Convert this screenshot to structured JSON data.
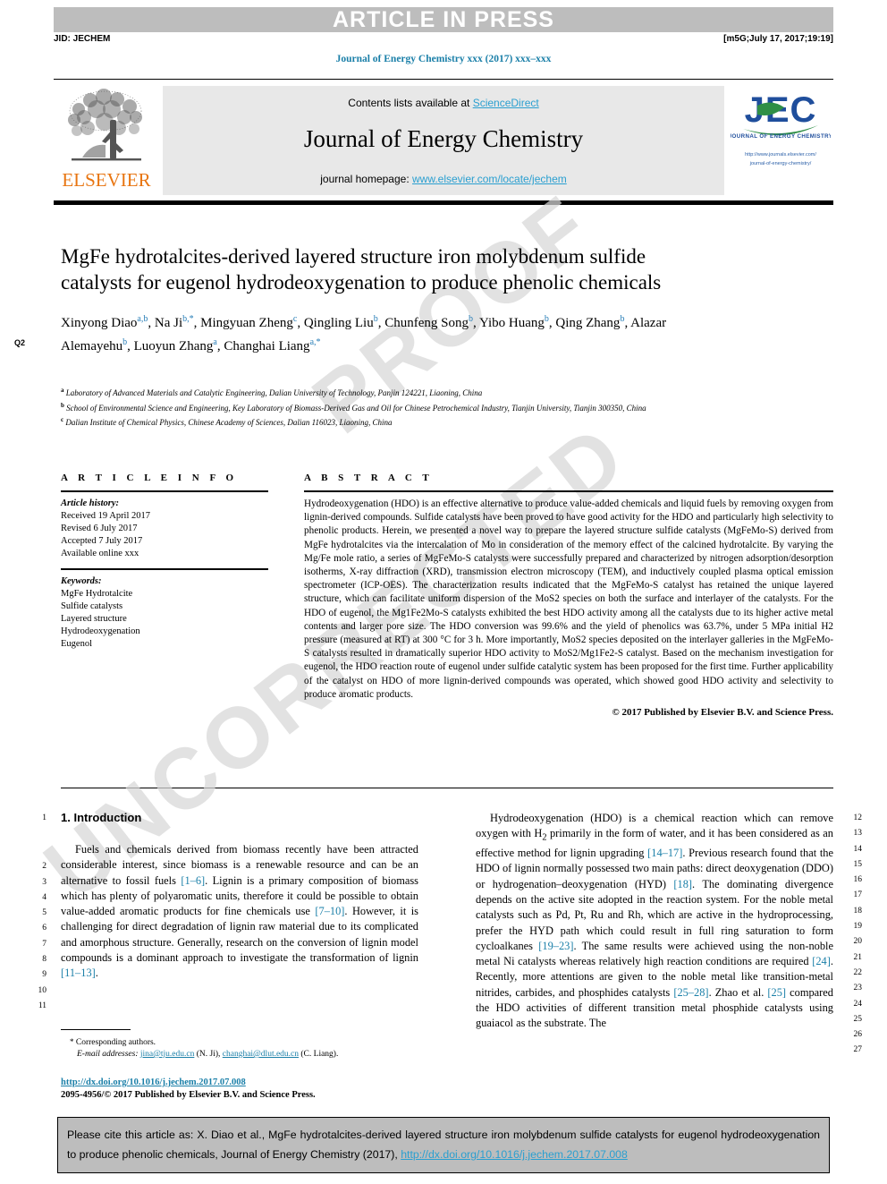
{
  "header": {
    "banner": "ARTICLE IN PRESS",
    "jid": "JID: JECHEM",
    "build_stamp": "[m5G;July 17, 2017;19:19]",
    "journal_ref": "Journal of Energy Chemistry xxx (2017) xxx–xxx"
  },
  "masthead": {
    "contents_prefix": "Contents lists available at ",
    "sciencedirect": "ScienceDirect",
    "journal_title": "Journal of Energy Chemistry",
    "homepage_prefix": "journal homepage: ",
    "homepage_url": "www.elsevier.com/locate/jechem",
    "elsevier_wordmark": "ELSEVIER",
    "jec_wordmark": "JEC",
    "jec_tagline": "JOURNAL OF ENERGY CHEMISTRY",
    "jec_url_line1": "http://www.journals.elsevier.com/",
    "jec_url_line2": "journal-of-energy-chemistry/"
  },
  "article": {
    "title": "MgFe hydrotalcites-derived layered structure iron molybdenum sulfide catalysts for eugenol hydrodeoxygenation to produce phenolic chemicals",
    "query_marker": "Q2",
    "authors": [
      {
        "name": "Xinyong Diao",
        "marks": "a,b",
        "sep": ", "
      },
      {
        "name": "Na Ji",
        "marks": "b,*",
        "sep": ", "
      },
      {
        "name": "Mingyuan Zheng",
        "marks": "c",
        "sep": ", "
      },
      {
        "name": "Qingling Liu",
        "marks": "b",
        "sep": ", "
      },
      {
        "name": "Chunfeng Song",
        "marks": "b",
        "sep": ", "
      },
      {
        "name": "Yibo Huang",
        "marks": "b",
        "sep": ", "
      },
      {
        "name": "Qing Zhang",
        "marks": "b",
        "sep": ", "
      },
      {
        "name": "Alazar Alemayehu",
        "marks": "b",
        "sep": ", "
      },
      {
        "name": "Luoyun Zhang",
        "marks": "a",
        "sep": ", "
      },
      {
        "name": "Changhai Liang",
        "marks": "a,*",
        "sep": ""
      }
    ],
    "affiliations": [
      {
        "mark": "a",
        "text": "Laboratory of Advanced Materials and Catalytic Engineering, Dalian University of Technology, Panjin 124221, Liaoning, China"
      },
      {
        "mark": "b",
        "text": "School of Environmental Science and Engineering, Key Laboratory of Biomass-Derived Gas and Oil for Chinese Petrochemical Industry, Tianjin University, Tianjin 300350, China"
      },
      {
        "mark": "c",
        "text": "Dalian Institute of Chemical Physics, Chinese Academy of Sciences, Dalian 116023, Liaoning, China"
      }
    ]
  },
  "article_info": {
    "heading": "A R T I C L E    I N F O",
    "history_label": "Article history:",
    "history": [
      "Received 19 April 2017",
      "Revised 6 July 2017",
      "Accepted 7 July 2017",
      "Available online xxx"
    ],
    "keywords_label": "Keywords:",
    "keywords": [
      "MgFe Hydrotalcite",
      "Sulfide catalysts",
      "Layered structure",
      "Hydrodeoxygenation",
      "Eugenol"
    ]
  },
  "abstract": {
    "heading": "A B S T R A C T",
    "body": "Hydrodeoxygenation (HDO) is an effective alternative to produce value-added chemicals and liquid fuels by removing oxygen from lignin-derived compounds. Sulfide catalysts have been proved to have good activity for the HDO and particularly high selectivity to phenolic products. Herein, we presented a novel way to prepare the layered structure sulfide catalysts (MgFeMo-S) derived from MgFe hydrotalcites via the intercalation of Mo in consideration of the memory effect of the calcined hydrotalcite. By varying the Mg/Fe mole ratio, a series of MgFeMo-S catalysts were successfully prepared and characterized by nitrogen adsorption/desorption isotherms, X-ray diffraction (XRD), transmission electron microscopy (TEM), and inductively coupled plasma optical emission spectrometer (ICP-OES). The characterization results indicated that the MgFeMo-S catalyst has retained the unique layered structure, which can facilitate uniform dispersion of the MoS2 species on both the surface and interlayer of the catalysts. For the HDO of eugenol, the Mg1Fe2Mo-S catalysts exhibited the best HDO activity among all the catalysts due to its higher active metal contents and larger pore size. The HDO conversion was 99.6% and the yield of phenolics was 63.7%, under 5 MPa initial H2 pressure (measured at RT) at 300 °C for 3 h. More importantly, MoS2 species deposited on the interlayer galleries in the MgFeMo-S catalysts resulted in dramatically superior HDO activity to MoS2/Mg1Fe2-S catalyst. Based on the mechanism investigation for eugenol, the HDO reaction route of eugenol under sulfide catalytic system has been proposed for the first time. Further applicability of the catalyst on HDO of more lignin-derived compounds was operated, which showed good HDO activity and selectivity to produce aromatic products.",
    "copyright": "© 2017 Published by Elsevier B.V. and Science Press."
  },
  "introduction": {
    "heading": "1. Introduction",
    "left_paragraph": "Fuels and chemicals derived from biomass recently have been attracted considerable interest, since biomass is a renewable resource and can be an alternative to fossil fuels [1–6]. Lignin is a primary composition of biomass which has plenty of polyaromatic units, therefore it could be possible to obtain value-added aromatic products for fine chemicals use [7–10]. However, it is challenging for direct degradation of lignin raw material due to its complicated and amorphous structure. Generally, research on the conversion of lignin model compounds is a dominant approach to investigate the transformation of lignin [11–13].",
    "right_paragraph": "Hydrodeoxygenation (HDO) is a chemical reaction which can remove oxygen with H2 primarily in the form of water, and it has been considered as an effective method for lignin upgrading [14–17]. Previous research found that the HDO of lignin normally possessed two main paths: direct deoxygenation (DDO) or hydrogenation–deoxygenation (HYD) [18]. The dominating divergence depends on the active site adopted in the reaction system. For the noble metal catalysts such as Pd, Pt, Ru and Rh, which are active in the hydroprocessing, prefer the HYD path which could result in full ring saturation to form cycloalkanes [19–23]. The same results were achieved using the non-noble metal Ni catalysts whereas relatively high reaction conditions are required [24]. Recently, more attentions are given to the noble metal like transition-metal nitrides, carbides, and phosphides catalysts [25–28]. Zhao et al. [25] compared the HDO activities of different transition metal phosphide catalysts using guaiacol as the substrate. The",
    "line_numbers_left": [
      "1",
      "2",
      "3",
      "4",
      "5",
      "6",
      "7",
      "8",
      "9",
      "10",
      "11"
    ],
    "line_numbers_right": [
      "12",
      "13",
      "14",
      "15",
      "16",
      "17",
      "18",
      "19",
      "20",
      "21",
      "22",
      "23",
      "24",
      "25",
      "26",
      "27"
    ]
  },
  "footnote": {
    "star": "*",
    "corresponding": "Corresponding authors.",
    "email_label": "E-mail addresses:",
    "email1": "jina@tju.edu.cn",
    "email1_who": "(N. Ji)",
    "email2": "changhai@dlut.edu.cn",
    "email2_who": "(C. Liang)."
  },
  "footer": {
    "doi": "http://dx.doi.org/10.1016/j.jechem.2017.07.008",
    "issn": "2095-4956/© 2017 Published by Elsevier B.V. and Science Press."
  },
  "citation_box": {
    "text_before": "Please cite this article as: X. Diao et al., MgFe hydrotalcites-derived layered structure iron molybdenum sulfide catalysts for eugenol hydrodeoxygenation to produce phenolic chemicals, Journal of Energy Chemistry (2017), ",
    "link": "http://dx.doi.org/10.1016/j.jechem.2017.07.008"
  },
  "watermark": {
    "line1": "UNCORRECTED",
    "line2": "PROOF"
  },
  "colors": {
    "link": "#2a9fd0",
    "cite": "#1a7fa8",
    "elsevier_orange": "#e87511",
    "jec_blue": "#1f4e9c",
    "jec_green": "#2f8f46",
    "banner_gray": "#bdbdbd",
    "masthead_gray": "#e8e8e8"
  }
}
